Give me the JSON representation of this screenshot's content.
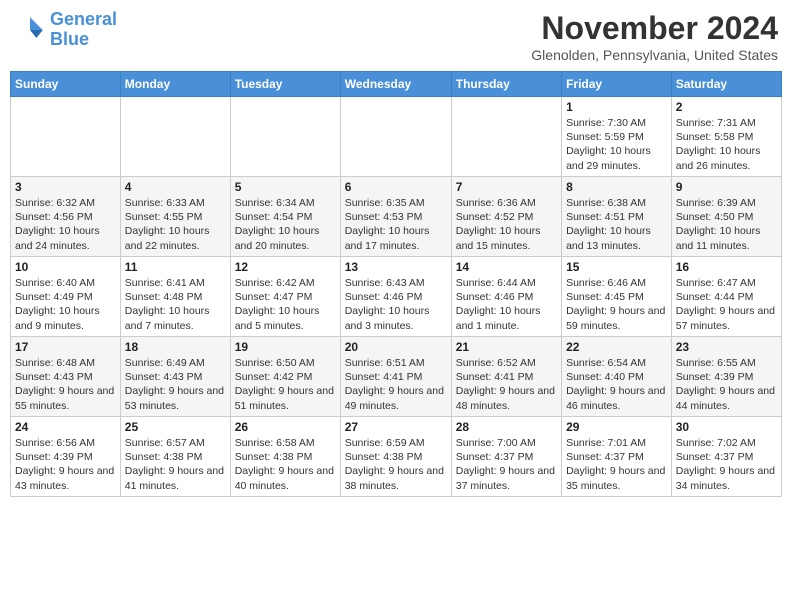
{
  "header": {
    "logo_line1": "General",
    "logo_line2": "Blue",
    "month_title": "November 2024",
    "subtitle": "Glenolden, Pennsylvania, United States"
  },
  "days_of_week": [
    "Sunday",
    "Monday",
    "Tuesday",
    "Wednesday",
    "Thursday",
    "Friday",
    "Saturday"
  ],
  "weeks": [
    [
      {
        "day": "",
        "info": ""
      },
      {
        "day": "",
        "info": ""
      },
      {
        "day": "",
        "info": ""
      },
      {
        "day": "",
        "info": ""
      },
      {
        "day": "",
        "info": ""
      },
      {
        "day": "1",
        "info": "Sunrise: 7:30 AM\nSunset: 5:59 PM\nDaylight: 10 hours and 29 minutes."
      },
      {
        "day": "2",
        "info": "Sunrise: 7:31 AM\nSunset: 5:58 PM\nDaylight: 10 hours and 26 minutes."
      }
    ],
    [
      {
        "day": "3",
        "info": "Sunrise: 6:32 AM\nSunset: 4:56 PM\nDaylight: 10 hours and 24 minutes."
      },
      {
        "day": "4",
        "info": "Sunrise: 6:33 AM\nSunset: 4:55 PM\nDaylight: 10 hours and 22 minutes."
      },
      {
        "day": "5",
        "info": "Sunrise: 6:34 AM\nSunset: 4:54 PM\nDaylight: 10 hours and 20 minutes."
      },
      {
        "day": "6",
        "info": "Sunrise: 6:35 AM\nSunset: 4:53 PM\nDaylight: 10 hours and 17 minutes."
      },
      {
        "day": "7",
        "info": "Sunrise: 6:36 AM\nSunset: 4:52 PM\nDaylight: 10 hours and 15 minutes."
      },
      {
        "day": "8",
        "info": "Sunrise: 6:38 AM\nSunset: 4:51 PM\nDaylight: 10 hours and 13 minutes."
      },
      {
        "day": "9",
        "info": "Sunrise: 6:39 AM\nSunset: 4:50 PM\nDaylight: 10 hours and 11 minutes."
      }
    ],
    [
      {
        "day": "10",
        "info": "Sunrise: 6:40 AM\nSunset: 4:49 PM\nDaylight: 10 hours and 9 minutes."
      },
      {
        "day": "11",
        "info": "Sunrise: 6:41 AM\nSunset: 4:48 PM\nDaylight: 10 hours and 7 minutes."
      },
      {
        "day": "12",
        "info": "Sunrise: 6:42 AM\nSunset: 4:47 PM\nDaylight: 10 hours and 5 minutes."
      },
      {
        "day": "13",
        "info": "Sunrise: 6:43 AM\nSunset: 4:46 PM\nDaylight: 10 hours and 3 minutes."
      },
      {
        "day": "14",
        "info": "Sunrise: 6:44 AM\nSunset: 4:46 PM\nDaylight: 10 hours and 1 minute."
      },
      {
        "day": "15",
        "info": "Sunrise: 6:46 AM\nSunset: 4:45 PM\nDaylight: 9 hours and 59 minutes."
      },
      {
        "day": "16",
        "info": "Sunrise: 6:47 AM\nSunset: 4:44 PM\nDaylight: 9 hours and 57 minutes."
      }
    ],
    [
      {
        "day": "17",
        "info": "Sunrise: 6:48 AM\nSunset: 4:43 PM\nDaylight: 9 hours and 55 minutes."
      },
      {
        "day": "18",
        "info": "Sunrise: 6:49 AM\nSunset: 4:43 PM\nDaylight: 9 hours and 53 minutes."
      },
      {
        "day": "19",
        "info": "Sunrise: 6:50 AM\nSunset: 4:42 PM\nDaylight: 9 hours and 51 minutes."
      },
      {
        "day": "20",
        "info": "Sunrise: 6:51 AM\nSunset: 4:41 PM\nDaylight: 9 hours and 49 minutes."
      },
      {
        "day": "21",
        "info": "Sunrise: 6:52 AM\nSunset: 4:41 PM\nDaylight: 9 hours and 48 minutes."
      },
      {
        "day": "22",
        "info": "Sunrise: 6:54 AM\nSunset: 4:40 PM\nDaylight: 9 hours and 46 minutes."
      },
      {
        "day": "23",
        "info": "Sunrise: 6:55 AM\nSunset: 4:39 PM\nDaylight: 9 hours and 44 minutes."
      }
    ],
    [
      {
        "day": "24",
        "info": "Sunrise: 6:56 AM\nSunset: 4:39 PM\nDaylight: 9 hours and 43 minutes."
      },
      {
        "day": "25",
        "info": "Sunrise: 6:57 AM\nSunset: 4:38 PM\nDaylight: 9 hours and 41 minutes."
      },
      {
        "day": "26",
        "info": "Sunrise: 6:58 AM\nSunset: 4:38 PM\nDaylight: 9 hours and 40 minutes."
      },
      {
        "day": "27",
        "info": "Sunrise: 6:59 AM\nSunset: 4:38 PM\nDaylight: 9 hours and 38 minutes."
      },
      {
        "day": "28",
        "info": "Sunrise: 7:00 AM\nSunset: 4:37 PM\nDaylight: 9 hours and 37 minutes."
      },
      {
        "day": "29",
        "info": "Sunrise: 7:01 AM\nSunset: 4:37 PM\nDaylight: 9 hours and 35 minutes."
      },
      {
        "day": "30",
        "info": "Sunrise: 7:02 AM\nSunset: 4:37 PM\nDaylight: 9 hours and 34 minutes."
      }
    ]
  ],
  "colors": {
    "header_bg": "#4a90d9",
    "header_text": "#ffffff",
    "accent": "#4a90d9"
  }
}
